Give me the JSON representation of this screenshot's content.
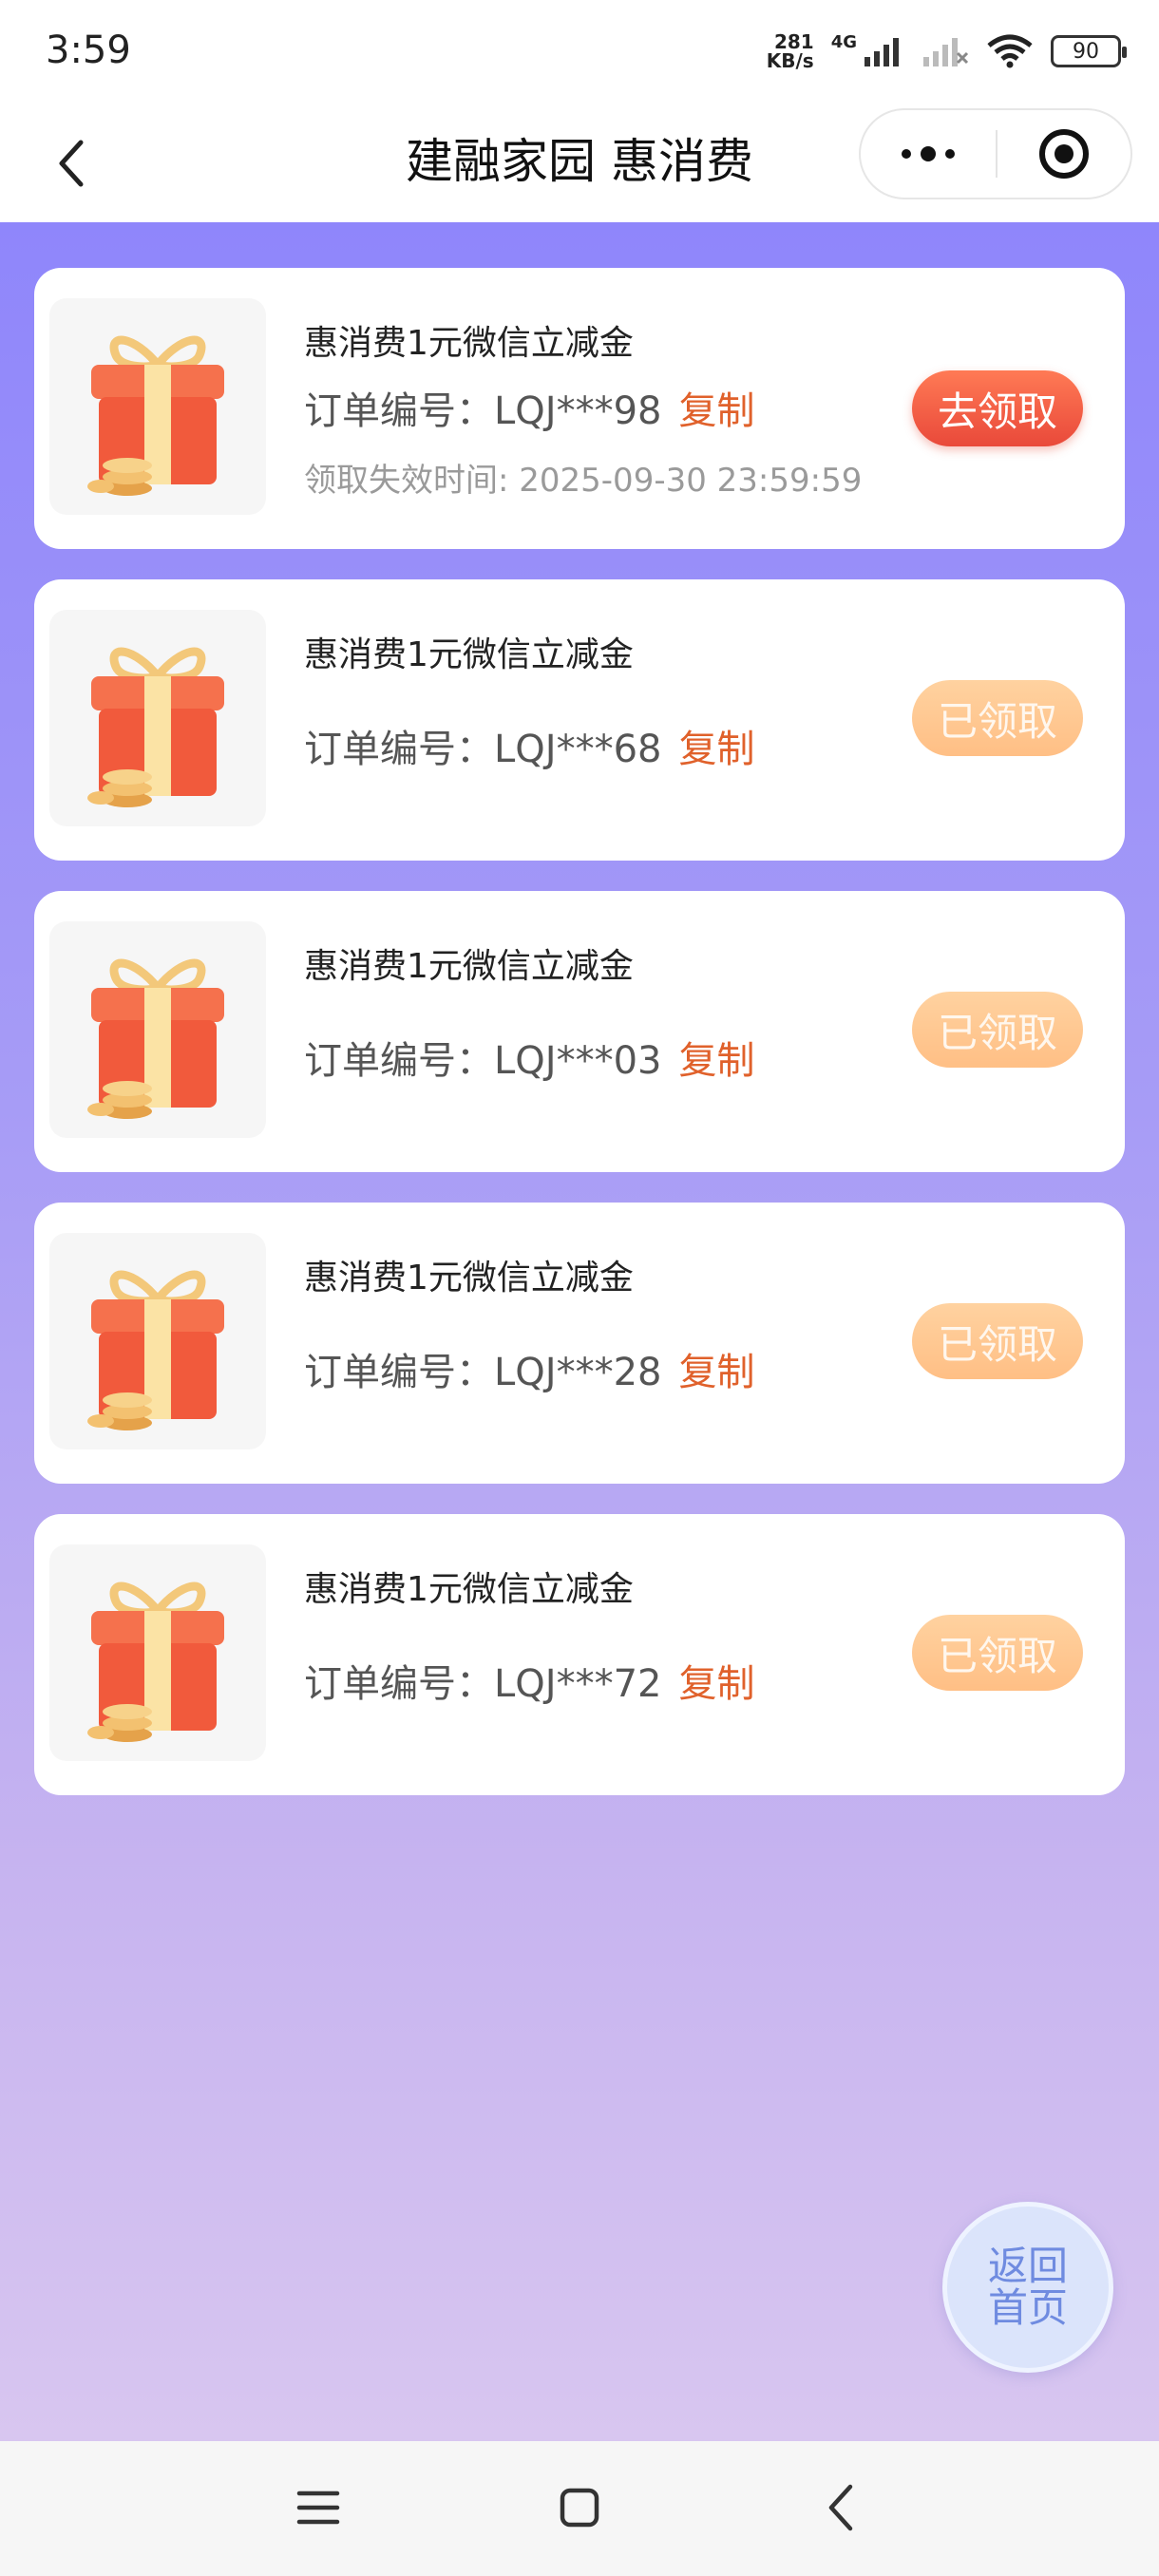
{
  "status_bar": {
    "time": "3:59",
    "speed_value": "281",
    "speed_unit": "KB/s",
    "network": "4G",
    "battery": "90"
  },
  "nav": {
    "title": "建融家园 惠消费",
    "icons": {
      "back": "chevron-left-icon",
      "more": "more-dots-icon",
      "close": "target-circle-icon"
    }
  },
  "colors": {
    "bg_top": "#8f86fb",
    "bg_bottom": "#d8c6f0",
    "accent": "#e0612b",
    "claim_active": "#ef5a3f",
    "claim_done": "#ffc894"
  },
  "cards": [
    {
      "title": "惠消费1元微信立减金",
      "order_label": "订单编号：",
      "order_no": "LQJ***98",
      "copy": "复制",
      "expire_label": "领取失效时间: ",
      "expire_time": "2025-09-30 23:59:59",
      "button": "去领取",
      "status": "active"
    },
    {
      "title": "惠消费1元微信立减金",
      "order_label": "订单编号：",
      "order_no": "LQJ***68",
      "copy": "复制",
      "button": "已领取",
      "status": "claimed"
    },
    {
      "title": "惠消费1元微信立减金",
      "order_label": "订单编号：",
      "order_no": "LQJ***03",
      "copy": "复制",
      "button": "已领取",
      "status": "claimed"
    },
    {
      "title": "惠消费1元微信立减金",
      "order_label": "订单编号：",
      "order_no": "LQJ***28",
      "copy": "复制",
      "button": "已领取",
      "status": "claimed"
    },
    {
      "title": "惠消费1元微信立减金",
      "order_label": "订单编号：",
      "order_no": "LQJ***72",
      "copy": "复制",
      "button": "已领取",
      "status": "claimed"
    }
  ],
  "home_button": "返回首页",
  "system_nav": {
    "menu": "menu-icon",
    "home": "home-square-icon",
    "back": "back-chevron-icon"
  }
}
